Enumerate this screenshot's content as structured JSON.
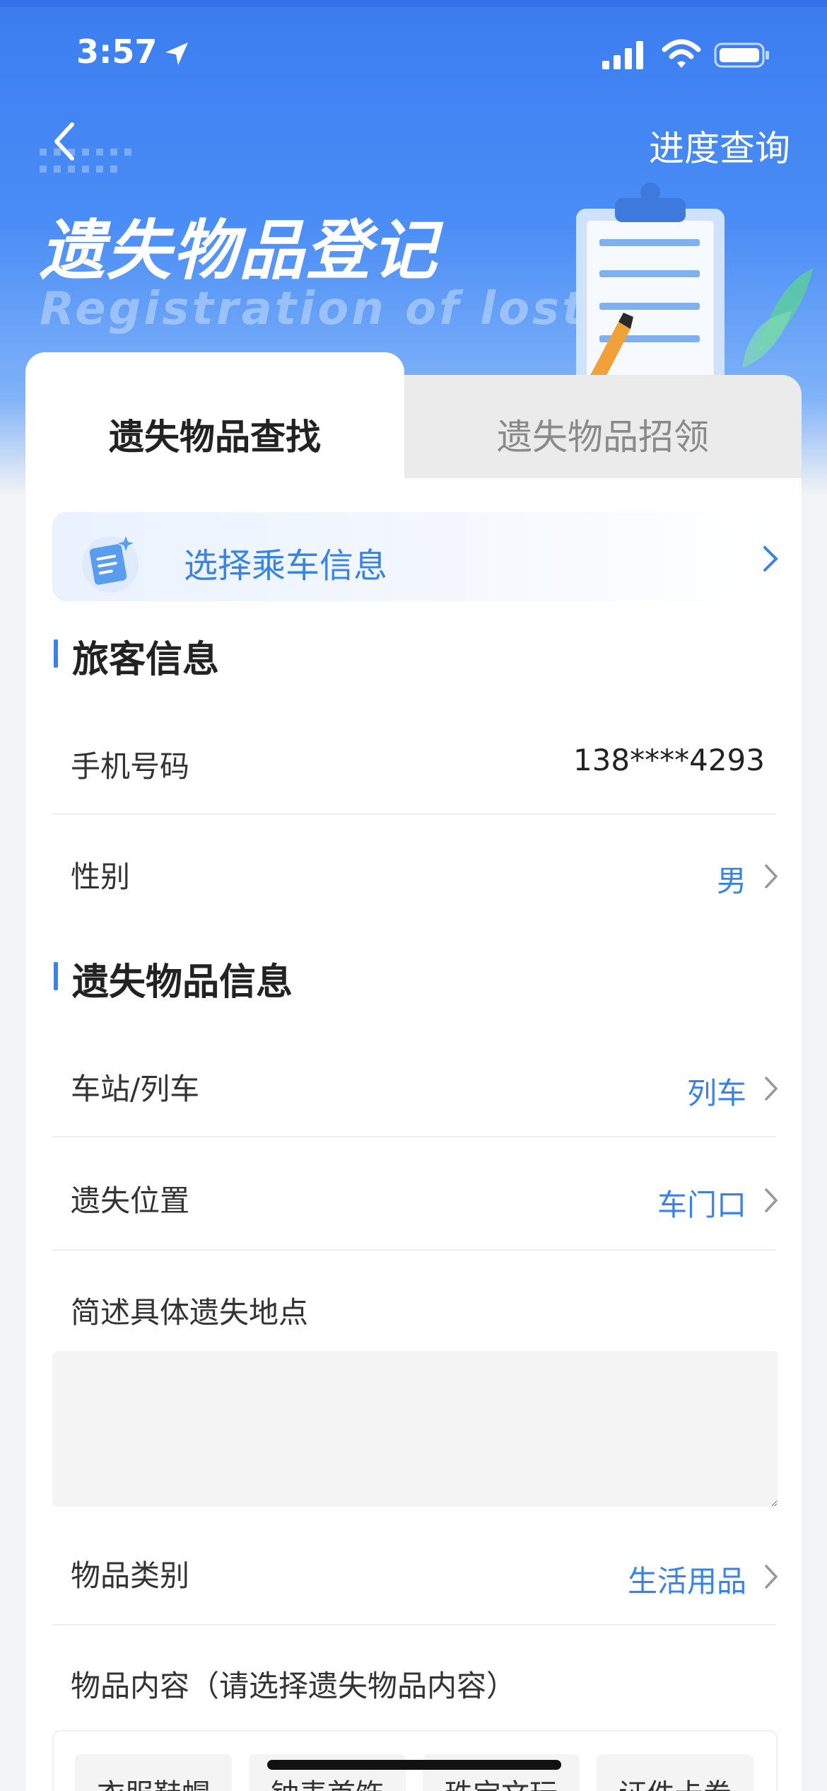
{
  "status_bar": {
    "time": "3:57"
  },
  "header": {
    "progress_link": "进度查询",
    "title_cn": "遗失物品登记",
    "title_en": "Registration of lost"
  },
  "tabs": [
    {
      "label": "遗失物品查找",
      "active": true
    },
    {
      "label": "遗失物品招领",
      "active": false
    }
  ],
  "ride_info": {
    "label": "选择乘车信息"
  },
  "passenger_section": {
    "title": "旅客信息",
    "phone_label": "手机号码",
    "phone_value": "138****4293",
    "gender_label": "性别",
    "gender_value": "男"
  },
  "item_section": {
    "title": "遗失物品信息",
    "station_label": "车站/列车",
    "station_value": "列车",
    "location_label": "遗失位置",
    "location_value": "车门口",
    "describe_label": "简述具体遗失地点",
    "describe_value": "",
    "category_label": "物品类别",
    "category_value": "生活用品",
    "content_label": "物品内容（请选择遗失物品内容）",
    "content_options": [
      "衣服鞋帽",
      "钟表首饰",
      "珠宝文玩",
      "证件卡券"
    ]
  },
  "colors": {
    "accent": "#3a83e6",
    "header": "#3b7df0"
  }
}
